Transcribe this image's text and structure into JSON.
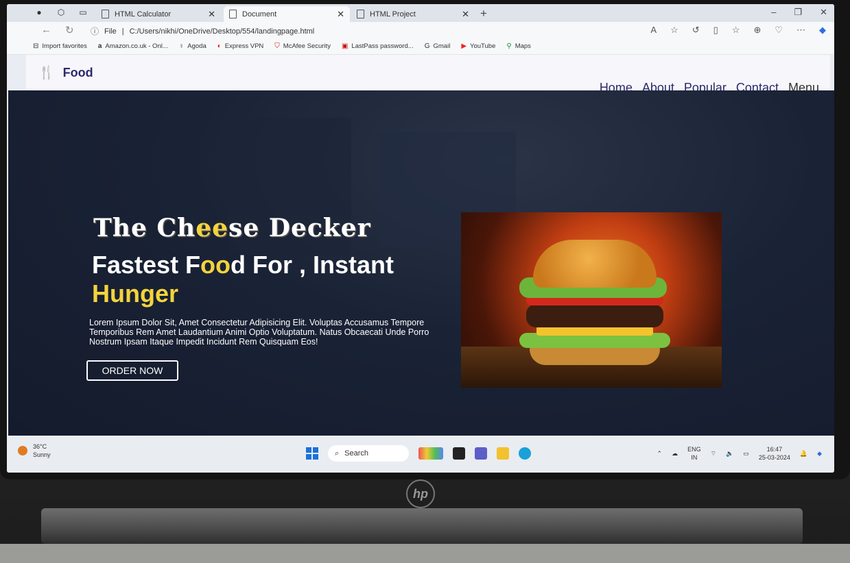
{
  "browser": {
    "tabs": [
      {
        "title": "HTML Calculator"
      },
      {
        "title": "Document"
      },
      {
        "title": "HTML Project"
      }
    ],
    "file_label": "File",
    "url": "C:/Users/nikhi/OneDrive/Desktop/554/landingpage.html",
    "bookmarks": [
      {
        "label": "Import favorites",
        "icon": "import-icon"
      },
      {
        "label": "Amazon.co.uk - Onl...",
        "icon": "a"
      },
      {
        "label": "Agoda",
        "icon": "agoda-icon"
      },
      {
        "label": "Express VPN",
        "icon": "vpn-icon"
      },
      {
        "label": "McAfee Security",
        "icon": "shield-icon"
      },
      {
        "label": "LastPass password...",
        "icon": "lastpass-icon"
      },
      {
        "label": "Gmail",
        "icon": "G"
      },
      {
        "label": "YouTube",
        "icon": "youtube-icon"
      },
      {
        "label": "Maps",
        "icon": "map-pin-icon"
      }
    ]
  },
  "site": {
    "logo_text": "Food",
    "nav": [
      "Home",
      "About",
      "Popular",
      "Contact",
      "Menu"
    ],
    "title_parts": [
      "The Ch",
      "ee",
      "se Decker"
    ],
    "headline_parts": [
      "Fastest F",
      "oo",
      "d For , Instant"
    ],
    "headline_line2": "Hunger",
    "description": "Lorem Ipsum Dolor Sit, Amet Consectetur Adipisicing Elit. Voluptas Accusamus Tempore Temporibus Rem Amet Laudantium Animi Optio Voluptatum. Natus Obcaecati Unde Porro Nostrum Ipsam Itaque Impedit Incidunt Rem Quisquam Eos!",
    "cta_label": "ORDER NOW",
    "accent_color": "#f3d33c"
  },
  "taskbar": {
    "temperature": "36°C",
    "weather": "Sunny",
    "search_label": "Search",
    "lang_top": "ENG",
    "lang_bottom": "IN",
    "time": "16:47",
    "date": "25-03-2024"
  },
  "device": {
    "brand_logo": "hp"
  }
}
